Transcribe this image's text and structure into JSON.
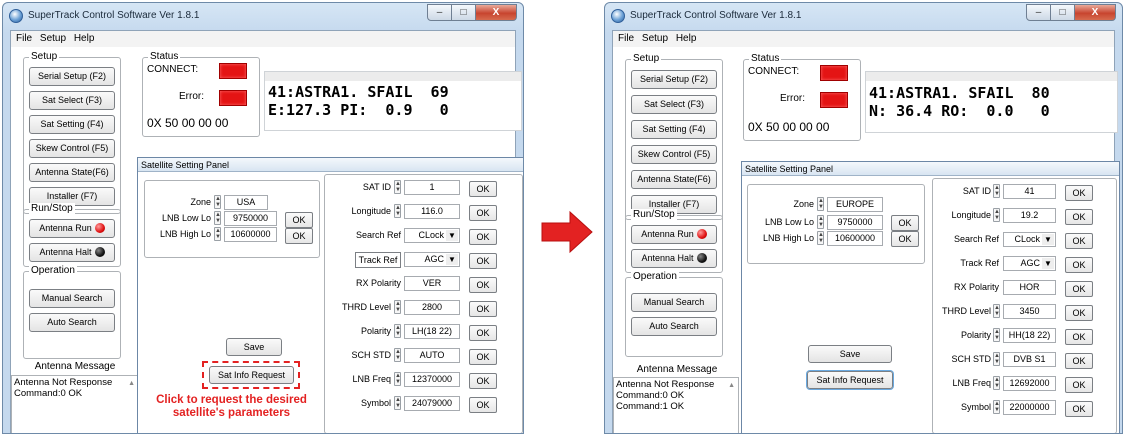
{
  "window_title": "SuperTrack Control Software Ver 1.8.1",
  "window_buttons": {
    "minimize": "–",
    "maximize": "□",
    "close": "X"
  },
  "menu": [
    "File",
    "Setup",
    "Help"
  ],
  "setup_group": {
    "label": "Setup",
    "buttons": [
      "Serial Setup (F2)",
      "Sat Select (F3)",
      "Sat Setting (F4)",
      "Skew Control (F5)",
      "Antenna State(F6)",
      "Installer (F7)"
    ]
  },
  "runstop_group": {
    "label": "Run/Stop",
    "run_label": "Antenna Run",
    "halt_label": "Antenna Halt"
  },
  "operation_group": {
    "label": "Operation",
    "manual_label": "Manual Search",
    "auto_label": "Auto Search"
  },
  "antenna_message_label": "Antenna Message",
  "status_group": {
    "label": "Status",
    "connect_label": "CONNECT:",
    "error_label": "Error:",
    "hex_code": "0X 50 00 00 00"
  },
  "panel_title": "Satellite Setting Panel",
  "ok_label": "OK",
  "save_label": "Save",
  "sat_info_label": "Sat Info Request",
  "field_labels": {
    "zone": "Zone",
    "lnb_low": "LNB Low Lo",
    "lnb_high": "LNB High Lo",
    "sat_id": "SAT ID",
    "longitude": "Longitude",
    "search_ref": "Search Ref",
    "track_ref": "Track Ref",
    "rx_polarity": "RX Polarity",
    "thrd_level": "THRD Level",
    "polarity": "Polarity",
    "sch_std": "SCH STD",
    "lnb_freq": "LNB Freq",
    "symbol": "Symbol"
  },
  "combo_arrow": "▼",
  "annotation_text": "Click to request the desired satellite's parameters",
  "arrow_color": "#e32222",
  "before": {
    "lcd_line1": "41:ASTRA1. SFAIL  69",
    "lcd_line2": "E:127.3 PI:  0.9   0",
    "messages": [
      "Antenna Not Response",
      "Command:0 OK"
    ],
    "values": {
      "zone": "USA",
      "lnb_low": "9750000",
      "lnb_high": "10600000",
      "sat_id": "1",
      "longitude": "116.0",
      "search_ref": "CLock",
      "track_ref": "AGC",
      "rx_polarity": "VER",
      "thrd_level": "2800",
      "polarity": "LH(18 22)",
      "sch_std": "AUTO",
      "lnb_freq": "12370000",
      "symbol": "24079000"
    }
  },
  "after": {
    "lcd_line1": "41:ASTRA1. SFAIL  80",
    "lcd_line2": "N: 36.4 RO:  0.0   0",
    "messages": [
      "Antenna Not Response",
      "Command:0 OK",
      "Command:1 OK"
    ],
    "values": {
      "zone": "EUROPE",
      "lnb_low": "9750000",
      "lnb_high": "10600000",
      "sat_id": "41",
      "longitude": "19.2",
      "search_ref": "CLock",
      "track_ref": "AGC",
      "rx_polarity": "HOR",
      "thrd_level": "3450",
      "polarity": "HH(18 22)",
      "sch_std": "DVB S1",
      "lnb_freq": "12692000",
      "symbol": "22000000"
    }
  }
}
